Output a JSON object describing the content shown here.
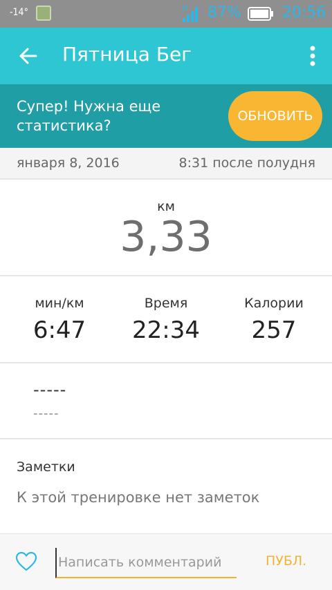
{
  "status_bar": {
    "temperature": "-14°",
    "network_type": "H",
    "battery_percent": "87%",
    "time": "20:56",
    "accent_color": "#2bb8e9"
  },
  "app_bar": {
    "title": "Пятница Бег",
    "back_icon": "arrow-left-icon",
    "menu_icon": "more-vertical-icon",
    "color": "#2ec6d3"
  },
  "promo": {
    "message": "Супер! Нужна еще статистика?",
    "button_label": "ОБНОВИТЬ",
    "button_color": "#f9b632"
  },
  "activity": {
    "date": "января 8, 2016",
    "time": "8:31 после полудня",
    "distance_unit": "км",
    "distance_value": "3,33"
  },
  "stats": [
    {
      "label": "мин/км",
      "value": "6:47"
    },
    {
      "label": "Время",
      "value": "22:34"
    },
    {
      "label": "Калории",
      "value": "257"
    }
  ],
  "extra": {
    "line1": "-----",
    "line2": "-----"
  },
  "notes": {
    "title": "Заметки",
    "body": "К этой тренировке нет заметок"
  },
  "comment_bar": {
    "heart_icon": "heart-outline-icon",
    "placeholder": "Написать комментарий",
    "value": "",
    "post_label": "ПУБЛ."
  }
}
